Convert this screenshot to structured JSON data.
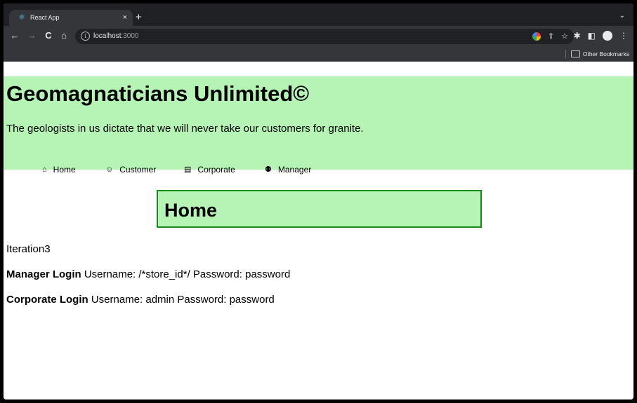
{
  "browser": {
    "tab_title": "React App",
    "tab_close": "×",
    "new_tab": "+",
    "tabs_menu": "⌄",
    "url_host": "localhost",
    "url_port": ":3000",
    "bookmarks_other": "Other Bookmarks",
    "icons": {
      "back": "←",
      "forward": "→",
      "reload": "C",
      "home": "⌂",
      "share": "⇧",
      "star": "☆",
      "extensions": "✱",
      "sidepanel": "◧",
      "menu": "⋮"
    }
  },
  "site": {
    "title": "Geomagnaticians Unlimited©",
    "tagline": "The geologists in us dictate that we will never take our customers for granite.",
    "nav": [
      {
        "label": "Home",
        "icon": "home-icon",
        "glyph": "⌂"
      },
      {
        "label": "Customer",
        "icon": "smile-icon",
        "glyph": "☺"
      },
      {
        "label": "Corporate",
        "icon": "building-icon",
        "glyph": "▤"
      },
      {
        "label": "Manager",
        "icon": "manager-icon",
        "glyph": "⚉"
      }
    ]
  },
  "main": {
    "heading": "Home",
    "iteration": "Iteration3",
    "manager_label": "Manager Login",
    "manager_text": " Username: /*store_id*/ Password: password",
    "corporate_label": "Corporate Login",
    "corporate_text": " Username: admin Password: password"
  },
  "colors": {
    "header_bg": "#b5f4b5",
    "home_border": "#1a8a1a",
    "chrome_dark": "#202124",
    "chrome_mid": "#35363a"
  }
}
